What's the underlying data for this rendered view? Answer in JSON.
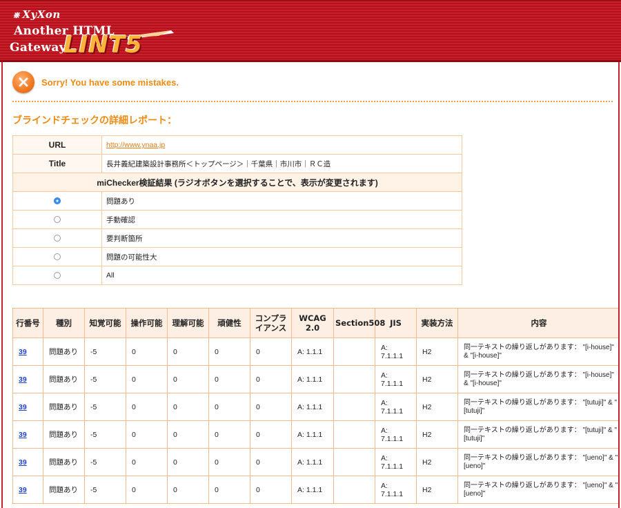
{
  "header": {
    "brand": "XyXon",
    "line1": "Another HTML",
    "line2": "Gateway",
    "lint": "LINT5"
  },
  "alert": {
    "message": "Sorry! You have some mistakes."
  },
  "section": {
    "title": "ブラインドチェックの詳細レポート："
  },
  "info": {
    "url_label": "URL",
    "url_value": "http://www.ynaa.jp",
    "title_label": "Title",
    "title_value": "長井義紀建築設計事務所＜トップページ＞｜千葉県｜市川市｜ＲＣ造",
    "michecker_header": "miChecker検証結果 (ラジオボタンを選択することで、表示が変更されます)",
    "radio_options": [
      {
        "label": "問題あり",
        "checked": true
      },
      {
        "label": "手動確認",
        "checked": false
      },
      {
        "label": "要判断箇所",
        "checked": false
      },
      {
        "label": "問題の可能性大",
        "checked": false
      },
      {
        "label": "All",
        "checked": false
      }
    ]
  },
  "results": {
    "columns": [
      "行番号",
      "種別",
      "知覚可能",
      "操作可能",
      "理解可能",
      "頑健性",
      "コンプライアンス",
      "WCAG 2.0",
      "Section508",
      "JIS",
      "実装方法",
      "内容"
    ],
    "rows": [
      {
        "line": "39",
        "type": "問題あり",
        "perceivable": "-5",
        "operable": "0",
        "understandable": "0",
        "robust": "0",
        "compliance": "0",
        "wcag": "A: 1.1.1",
        "section508": "",
        "jis": "A: 7.1.1.1",
        "method": "H2",
        "content": "同一テキストの繰り返しがあります： \"[i-house]\" & \"[i-house]\""
      },
      {
        "line": "39",
        "type": "問題あり",
        "perceivable": "-5",
        "operable": "0",
        "understandable": "0",
        "robust": "0",
        "compliance": "0",
        "wcag": "A: 1.1.1",
        "section508": "",
        "jis": "A: 7.1.1.1",
        "method": "H2",
        "content": "同一テキストの繰り返しがあります： \"[i-house]\" & \"[i-house]\""
      },
      {
        "line": "39",
        "type": "問題あり",
        "perceivable": "-5",
        "operable": "0",
        "understandable": "0",
        "robust": "0",
        "compliance": "0",
        "wcag": "A: 1.1.1",
        "section508": "",
        "jis": "A: 7.1.1.1",
        "method": "H2",
        "content": "同一テキストの繰り返しがあります： \"[tutuji]\" & \"[tutuji]\""
      },
      {
        "line": "39",
        "type": "問題あり",
        "perceivable": "-5",
        "operable": "0",
        "understandable": "0",
        "robust": "0",
        "compliance": "0",
        "wcag": "A: 1.1.1",
        "section508": "",
        "jis": "A: 7.1.1.1",
        "method": "H2",
        "content": "同一テキストの繰り返しがあります： \"[tutuji]\" & \"[tutuji]\""
      },
      {
        "line": "39",
        "type": "問題あり",
        "perceivable": "-5",
        "operable": "0",
        "understandable": "0",
        "robust": "0",
        "compliance": "0",
        "wcag": "A: 1.1.1",
        "section508": "",
        "jis": "A: 7.1.1.1",
        "method": "H2",
        "content": "同一テキストの繰り返しがあります： \"[ueno]\" & \"[ueno]\""
      },
      {
        "line": "39",
        "type": "問題あり",
        "perceivable": "-5",
        "operable": "0",
        "understandable": "0",
        "robust": "0",
        "compliance": "0",
        "wcag": "A: 1.1.1",
        "section508": "",
        "jis": "A: 7.1.1.1",
        "method": "H2",
        "content": "同一テキストの繰り返しがあります： \"[ueno]\" & \"[ueno]\""
      }
    ]
  },
  "colors": {
    "banner_red": "#c8202a",
    "accent_orange": "#ef8a12",
    "table_border": "#f3b98c",
    "link_blue": "#1a3fd4"
  }
}
